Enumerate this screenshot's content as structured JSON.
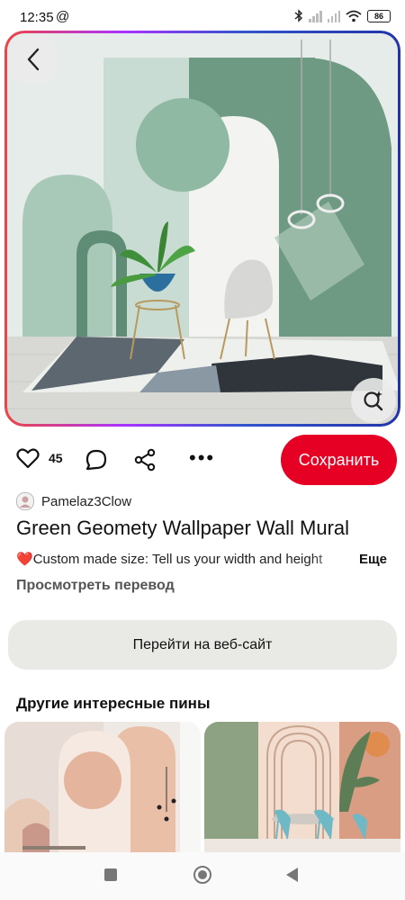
{
  "status_bar": {
    "time": "12:35",
    "at_icon": "@",
    "battery": "86"
  },
  "hero": {
    "back_icon": "chevron-left-icon",
    "lens_icon": "visual-search-icon"
  },
  "actions": {
    "like_count": "45",
    "more_label": "•••",
    "save_label": "Сохранить",
    "save_color": "#e60023"
  },
  "pin": {
    "author": "Pamelaz3Clow",
    "title": "Green Geomety Wallpaper Wall Mural",
    "description_emoji": "❤️",
    "description": "Custom made size: Tell us your width and height",
    "more_label": "Еще",
    "translate_label": "Просмотреть перевод",
    "visit_label": "Перейти на веб-сайт"
  },
  "related": {
    "section_title": "Другие интересные пины"
  }
}
